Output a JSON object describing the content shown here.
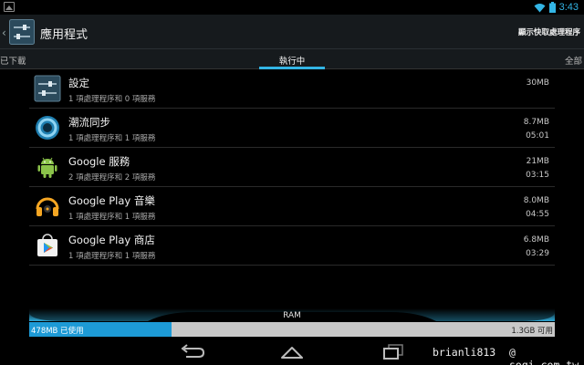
{
  "status": {
    "time": "3:43"
  },
  "action_bar": {
    "title": "應用程式",
    "action_label": "顯示快取處理程序"
  },
  "tabs": {
    "left": "已下載",
    "center": "執行中",
    "right": "全部"
  },
  "apps": [
    {
      "name": "設定",
      "detail": "1 項處理程序和 0 項服務",
      "size": "30MB",
      "time": "",
      "icon": "settings-icon"
    },
    {
      "name": "潮流同步",
      "detail": "1 項處理程序和 1 項服務",
      "size": "8.7MB",
      "time": "05:01",
      "icon": "currents-sync-icon"
    },
    {
      "name": "Google 服務",
      "detail": "2 項處理程序和 2 項服務",
      "size": "21MB",
      "time": "03:15",
      "icon": "android-icon"
    },
    {
      "name": "Google Play 音樂",
      "detail": "1 項處理程序和 1 項服務",
      "size": "8.0MB",
      "time": "04:55",
      "icon": "headphones-icon"
    },
    {
      "name": "Google Play 商店",
      "detail": "1 項處理程序和 1 項服務",
      "size": "6.8MB",
      "time": "03:29",
      "icon": "play-store-icon"
    }
  ],
  "ram": {
    "label": "RAM",
    "used": "478MB 已使用",
    "free": "1.3GB 可用",
    "used_fraction": 0.27
  },
  "watermark": {
    "user": "brianli813",
    "site": "@ sogi.com.tw"
  },
  "colors": {
    "accent": "#33b5e5",
    "ram_used": "#1d9ad6",
    "ram_free": "#c8c8c8"
  }
}
